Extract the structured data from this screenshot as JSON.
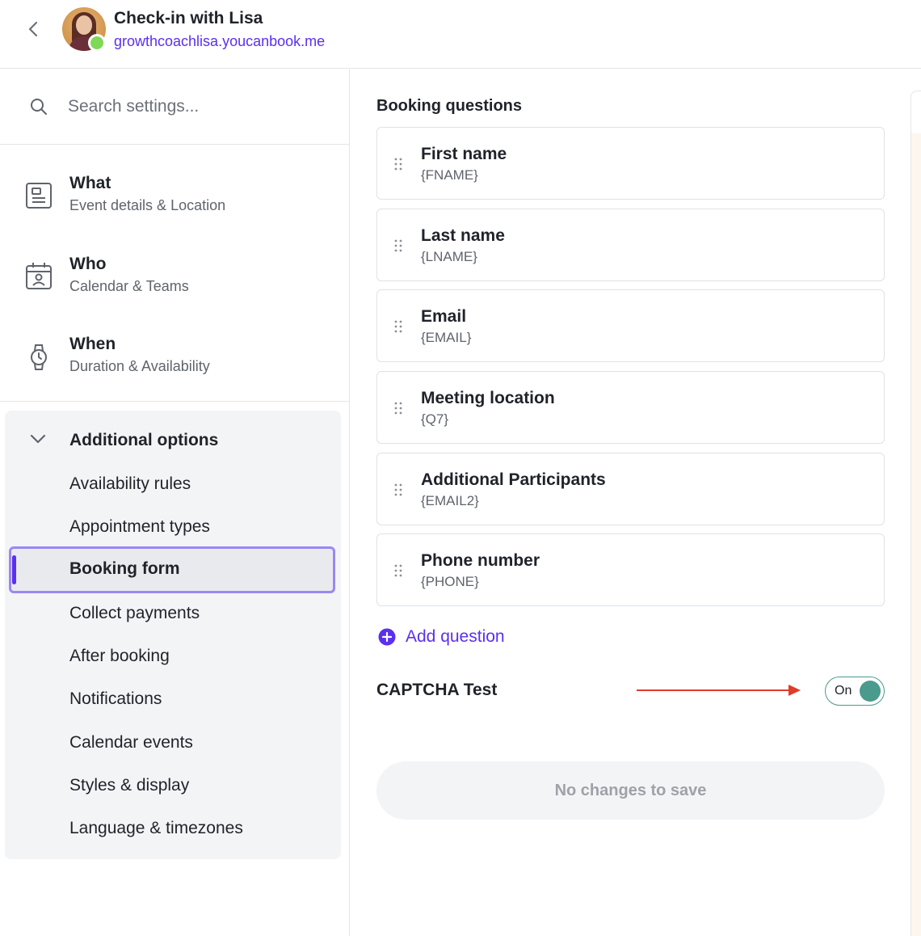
{
  "header": {
    "title": "Check-in with Lisa",
    "url": "growthcoachlisa.youcanbook.me"
  },
  "sidebar": {
    "search_placeholder": "Search settings...",
    "nav": [
      {
        "title": "What",
        "subtitle": "Event details & Location",
        "icon": "document-icon"
      },
      {
        "title": "Who",
        "subtitle": "Calendar & Teams",
        "icon": "calendar-person-icon"
      },
      {
        "title": "When",
        "subtitle": "Duration & Availability",
        "icon": "watch-icon"
      }
    ],
    "additional_options": {
      "label": "Additional options",
      "expanded": true,
      "items": [
        "Availability rules",
        "Appointment types",
        "Booking form",
        "Collect payments",
        "After booking",
        "Notifications",
        "Calendar events",
        "Styles & display",
        "Language & timezones"
      ],
      "active": "Booking form"
    }
  },
  "main": {
    "section_title": "Booking questions",
    "questions": [
      {
        "title": "First name",
        "key": "{FNAME}"
      },
      {
        "title": "Last name",
        "key": "{LNAME}"
      },
      {
        "title": "Email",
        "key": "{EMAIL}"
      },
      {
        "title": "Meeting location",
        "key": "{Q7}"
      },
      {
        "title": "Additional Participants",
        "key": "{EMAIL2}"
      },
      {
        "title": "Phone number",
        "key": "{PHONE}"
      }
    ],
    "add_question_label": "Add question",
    "captcha": {
      "label": "CAPTCHA Test",
      "toggle_label": "On",
      "enabled": true
    },
    "save_label": "No changes to save"
  },
  "colors": {
    "brand": "#5b2ff0",
    "toggle_on": "#4a9a8d",
    "annotation_arrow": "#e03c2a",
    "active_outline": "#9b87f5"
  }
}
